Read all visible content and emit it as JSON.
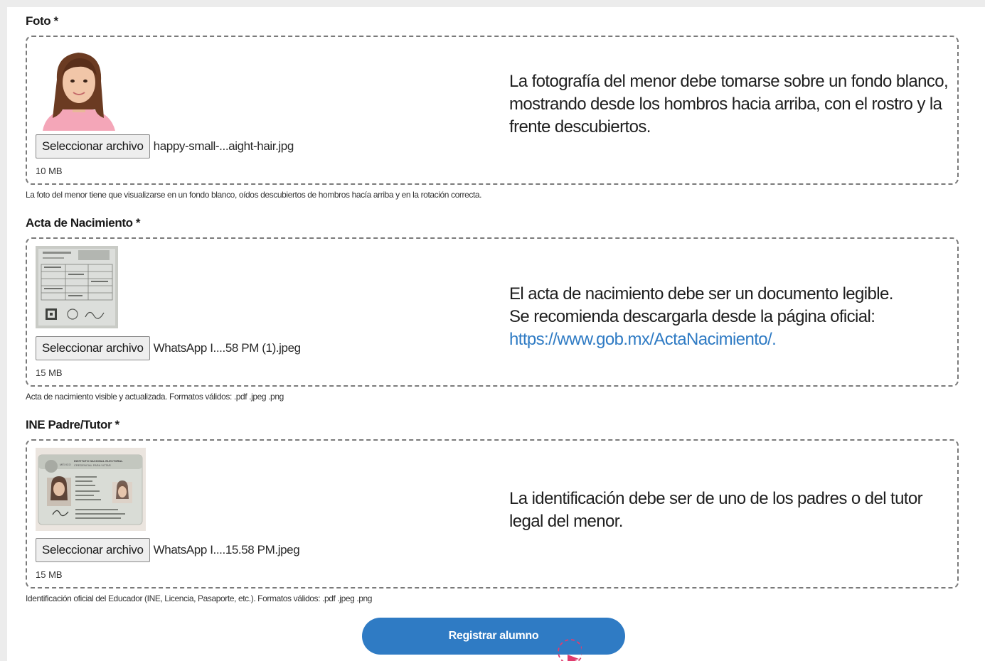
{
  "foto": {
    "label": "Foto *",
    "button_label": "Seleccionar archivo",
    "file_name": "happy-small-...aight-hair.jpg",
    "file_size": "10 MB",
    "info_text": "La fotografía del menor debe tomarse sobre un fondo blanco, mostrando desde los hombros hacia arriba, con el rostro y la frente descubiertos.",
    "hint": "La foto del menor tiene que visualizarse en un fondo blanco, oídos descubiertos de hombros hacía arriba y en la rotación correcta."
  },
  "acta": {
    "label": "Acta de Nacimiento *",
    "button_label": "Seleccionar archivo",
    "file_name": "WhatsApp I....58 PM (1).jpeg",
    "file_size": "15 MB",
    "info_line1": "El acta de nacimiento debe ser un documento legible.",
    "info_line2": "Se recomienda descargarla desde la página oficial:",
    "info_link": "https://www.gob.mx/ActaNacimiento/.",
    "hint": "Acta de nacimiento visible y actualizada. Formatos válidos: .pdf .jpeg .png"
  },
  "ine": {
    "label": "INE Padre/Tutor *",
    "button_label": "Seleccionar archivo",
    "file_name": "WhatsApp I....15.58 PM.jpeg",
    "file_size": "15 MB",
    "info_text": "La identificación debe ser de uno de los padres o del tutor legal del menor.",
    "card_title": "INSTITUTO NACIONAL ELECTORAL",
    "card_subtitle": "CREDENCIAL PARA VOTAR",
    "card_country": "MÉXICO",
    "hint": "Identificación oficial del Educador (INE, Licencia, Pasaporte, etc.). Formatos válidos: .pdf .jpeg .png"
  },
  "submit": {
    "label": "Registrar alumno"
  },
  "colors": {
    "accent": "#2f7bc4",
    "cursor": "#e03c6e"
  }
}
